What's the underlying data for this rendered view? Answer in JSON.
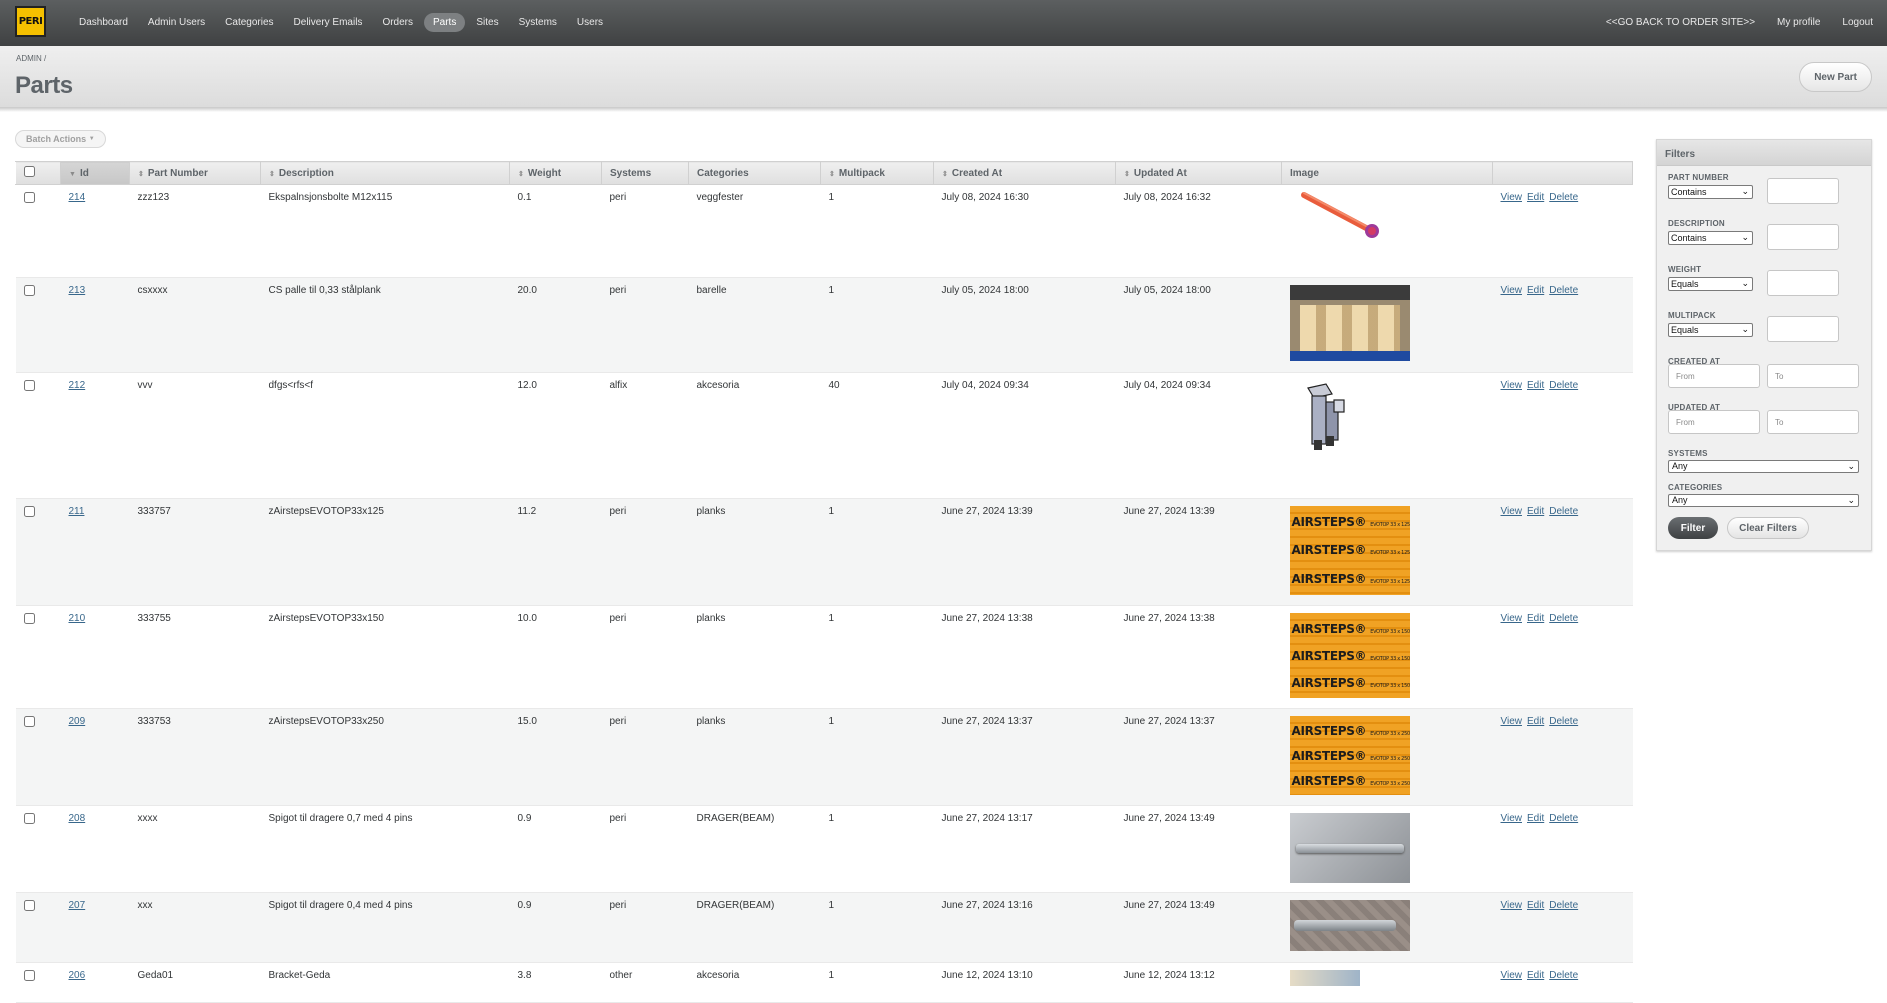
{
  "header": {
    "logo_text": "PERI",
    "nav": [
      "Dashboard",
      "Admin Users",
      "Categories",
      "Delivery Emails",
      "Orders",
      "Parts",
      "Sites",
      "Systems",
      "Users"
    ],
    "current": "Parts",
    "utility": [
      "<<GO BACK TO ORDER SITE>>",
      "My profile",
      "Logout"
    ]
  },
  "breadcrumb": "ADMIN /",
  "page_title": "Parts",
  "new_part_label": "New Part",
  "batch_actions_label": "Batch Actions",
  "table": {
    "columns": [
      "Id",
      "Part Number",
      "Description",
      "Weight",
      "Systems",
      "Categories",
      "Multipack",
      "Created At",
      "Updated At",
      "Image"
    ],
    "actions": [
      "View",
      "Edit",
      "Delete"
    ],
    "rows": [
      {
        "id": "214",
        "part_number": "zzz123",
        "description": "Ekspalnsjonsbolte M12x115",
        "weight": "0.1",
        "systems": "peri",
        "categories": "veggfester",
        "multipack": "1",
        "created_at": "July 08, 2024 16:30",
        "updated_at": "July 08, 2024 16:32",
        "image": "red-bolt"
      },
      {
        "id": "213",
        "part_number": "csxxxx",
        "description": "CS palle til 0,33 stålplank",
        "weight": "20.0",
        "systems": "peri",
        "categories": "barelle",
        "multipack": "1",
        "created_at": "July 05, 2024 18:00",
        "updated_at": "July 05, 2024 18:00",
        "image": "pallet-photo"
      },
      {
        "id": "212",
        "part_number": "vvv",
        "description": "dfgs<rfs<f",
        "weight": "12.0",
        "systems": "alfix",
        "categories": "akcesoria",
        "multipack": "40",
        "created_at": "July 04, 2024 09:34",
        "updated_at": "July 04, 2024 09:34",
        "image": "bracket-drawing"
      },
      {
        "id": "211",
        "part_number": "333757",
        "description": "zAirstepsEVOTOP33x125",
        "weight": "11.2",
        "systems": "peri",
        "categories": "planks",
        "multipack": "1",
        "created_at": "June 27, 2024 13:39",
        "updated_at": "June 27, 2024 13:39",
        "image": "airsteps-125"
      },
      {
        "id": "210",
        "part_number": "333755",
        "description": "zAirstepsEVOTOP33x150",
        "weight": "10.0",
        "systems": "peri",
        "categories": "planks",
        "multipack": "1",
        "created_at": "June 27, 2024 13:38",
        "updated_at": "June 27, 2024 13:38",
        "image": "airsteps-150"
      },
      {
        "id": "209",
        "part_number": "333753",
        "description": "zAirstepsEVOTOP33x250",
        "weight": "15.0",
        "systems": "peri",
        "categories": "planks",
        "multipack": "1",
        "created_at": "June 27, 2024 13:37",
        "updated_at": "June 27, 2024 13:37",
        "image": "airsteps-250"
      },
      {
        "id": "208",
        "part_number": "xxxx",
        "description": "Spigot til dragere 0,7 med 4 pins",
        "weight": "0.9",
        "systems": "peri",
        "categories": "DRAGER(BEAM)",
        "multipack": "1",
        "created_at": "June 27, 2024 13:17",
        "updated_at": "June 27, 2024 13:49",
        "image": "spigot-photo"
      },
      {
        "id": "207",
        "part_number": "xxx",
        "description": "Spigot til dragere 0,4 med 4 pins",
        "weight": "0.9",
        "systems": "peri",
        "categories": "DRAGER(BEAM)",
        "multipack": "1",
        "created_at": "June 27, 2024 13:16",
        "updated_at": "June 27, 2024 13:49",
        "image": "spigot-photo-2"
      },
      {
        "id": "206",
        "part_number": "Geda01",
        "description": "Bracket-Geda",
        "weight": "3.8",
        "systems": "other",
        "categories": "akcesoria",
        "multipack": "1",
        "created_at": "June 12, 2024 13:10",
        "updated_at": "June 12, 2024 13:12",
        "image": "geda-photo"
      }
    ],
    "airsteps_text": "AIRSTEPS®",
    "airsteps_small": [
      "EVOTOP 33 x 125cm",
      "EVOTOP 33 x 150cm",
      "EVOTOP 33 x 250cm"
    ]
  },
  "filters": {
    "title": "Filters",
    "part_number": {
      "label": "PART NUMBER",
      "operator": "Contains"
    },
    "description": {
      "label": "DESCRIPTION",
      "operator": "Contains"
    },
    "weight": {
      "label": "WEIGHT",
      "operator": "Equals"
    },
    "multipack": {
      "label": "MULTIPACK",
      "operator": "Equals"
    },
    "created_at": {
      "label": "CREATED AT",
      "from": "From",
      "to": "To"
    },
    "updated_at": {
      "label": "UPDATED AT",
      "from": "From",
      "to": "To"
    },
    "systems": {
      "label": "SYSTEMS",
      "value": "Any"
    },
    "categories": {
      "label": "CATEGORIES",
      "value": "Any"
    },
    "filter_button": "Filter",
    "clear_button": "Clear Filters"
  },
  "colors": {
    "header": "#4a4d4e",
    "link": "#38678b",
    "airsteps": "#f0a224"
  }
}
